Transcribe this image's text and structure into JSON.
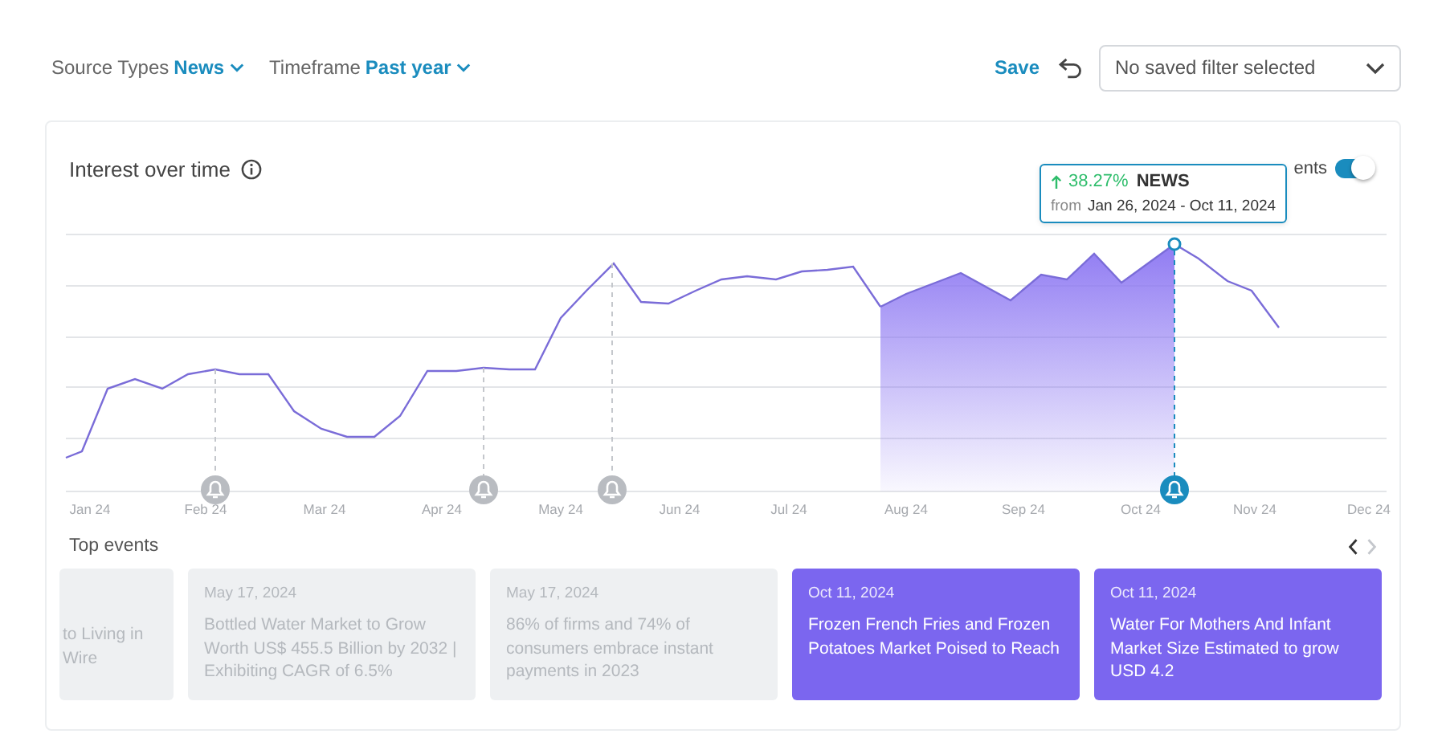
{
  "filters": [
    {
      "label": "Source Types",
      "value": "News"
    },
    {
      "label": "Timeframe",
      "value": "Past year"
    }
  ],
  "save_label": "Save",
  "saved_filter": {
    "placeholder": "No saved filter selected"
  },
  "panel": {
    "title": "Interest over time",
    "key_events_toggle": {
      "label_visible": "ents",
      "on": true
    },
    "tooltip": {
      "change": "38.27%",
      "source": "NEWS",
      "from_label": "from",
      "range": "Jan 26, 2024 - Oct 11, 2024"
    },
    "x_labels": [
      "Jan 24",
      "Feb 24",
      "Mar 24",
      "Apr 24",
      "May 24",
      "Jun 24",
      "Jul 24",
      "Aug 24",
      "Sep 24",
      "Oct 24",
      "Nov 24",
      "Dec 24"
    ],
    "event_markers": [
      {
        "selected": false
      },
      {
        "selected": false
      },
      {
        "selected": false
      },
      {
        "selected": true
      }
    ],
    "top_events_title": "Top events",
    "nav": {
      "prev_disabled": false,
      "next_disabled": true
    },
    "events": [
      {
        "title": "to Living in Wire",
        "highlighted": false
      },
      {
        "date": "May 17, 2024",
        "title": "Bottled Water Market to Grow Worth US$ 455.5 Billion by 2032 | Exhibiting CAGR of 6.5%",
        "highlighted": false
      },
      {
        "date": "May 17, 2024",
        "title": "86% of firms and 74% of consumers embrace instant payments in 2023",
        "highlighted": false
      },
      {
        "date": "Oct 11, 2024",
        "title": "Frozen French Fries and Frozen Potatoes Market Poised to Reach",
        "highlighted": true
      },
      {
        "date": "Oct 11, 2024",
        "title": "Water For Mothers And Infant Market Size Estimated to grow USD 4.2",
        "highlighted": true
      }
    ]
  }
}
